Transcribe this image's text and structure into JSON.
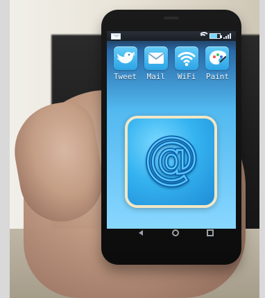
{
  "apps": [
    {
      "label": "Tweet",
      "icon": "bird-icon"
    },
    {
      "label": "Mail",
      "icon": "envelope-icon"
    },
    {
      "label": "WiFi",
      "icon": "wifi-icon"
    },
    {
      "label": "Paint",
      "icon": "palette-icon"
    }
  ],
  "hero": {
    "symbol": "@",
    "icon": "email-at-icon"
  },
  "colors": {
    "screen_top": "#2a6aa8",
    "screen_bottom": "#88d7ff",
    "accent": "#35b3f0",
    "icon_border": "#f1e7c5"
  }
}
